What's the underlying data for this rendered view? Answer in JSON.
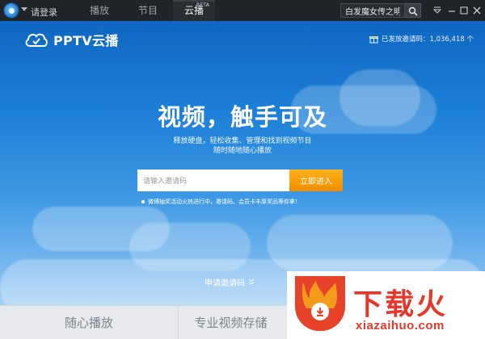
{
  "topbar": {
    "login_label": "请登录",
    "tabs": [
      {
        "label": "播放"
      },
      {
        "label": "节目"
      },
      {
        "label": "云播",
        "badge": "BETA"
      }
    ],
    "search_value": "白发魔女传之明月天国",
    "icons": {
      "logo": "pptv-logo-icon",
      "search": "search-icon",
      "menu": "menu-icon",
      "minimize": "minimize-icon",
      "maximize": "maximize-icon",
      "close": "close-icon"
    }
  },
  "hero": {
    "brand_name": "PPTV云播",
    "invites_label": "已发放邀请码：1,036,418 个",
    "headline": "视频，触手可及",
    "subline_1": "释放硬盘，轻松收集、管理和找到视频节目",
    "subline_2": "随时随地随心播放",
    "invite_placeholder": "请输入邀请码",
    "enter_button": "立即进入",
    "notice": "微博抽奖活动火热进行中，邀请码、会员卡丰厚奖品等你拿！",
    "apply_link": "申请邀请码"
  },
  "features": [
    {
      "label": "随心播放"
    },
    {
      "label": "专业视频存储"
    }
  ],
  "watermark": {
    "title": "下载火",
    "url": "xiazaihuo.com"
  },
  "colors": {
    "topbar_bg": "#202327",
    "sky_top": "#0f67c2",
    "sky_bottom": "#cfe5f8",
    "accent_orange": "#f08d00",
    "watermark_red": "#e6432a"
  }
}
